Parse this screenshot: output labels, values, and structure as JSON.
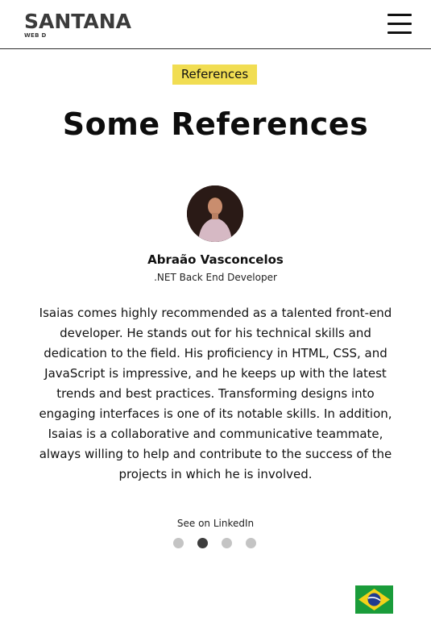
{
  "header": {
    "logo_main": "SANTANA",
    "logo_sub": "WEB D"
  },
  "section": {
    "badge": "References",
    "title": "Some References"
  },
  "testimonial": {
    "name": "Abraão Vasconcelos",
    "role": ".NET Back End Developer",
    "quote": "Isaias comes highly recommended as a talented front-end developer. He stands out for his technical skills and dedication to the field. His proficiency in HTML, CSS, and JavaScript is impressive, and he keeps up with the latest trends and best practices. Transforming designs into engaging interfaces is one of its notable skills. In addition, Isaias is a collaborative and communicative teammate, always willing to help and contribute to the success of the projects in which he is involved.",
    "link_label": "See on LinkedIn"
  },
  "carousel": {
    "count": 4,
    "active_index": 1
  },
  "language": {
    "flag_icon": "brazil-flag-icon"
  },
  "colors": {
    "badge_bg": "#f1dd52",
    "dot_active": "#3d3d3d",
    "dot_inactive": "#c4c4c4"
  }
}
